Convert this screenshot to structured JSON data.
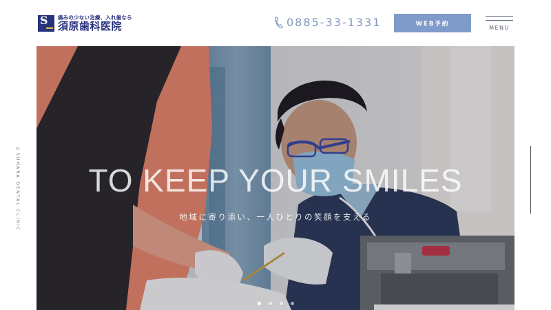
{
  "header": {
    "logo": {
      "tagline": "痛みの少ない治療、入れ歯なら",
      "name": "須原歯科医院",
      "mark_letter": "S"
    },
    "phone": {
      "icon": "phone-icon",
      "number": "0885-33-1331"
    },
    "web_reservation_label": "WEB予約",
    "menu_label": "MENU"
  },
  "side": {
    "copyright": "©SUHARA DENTAL CLINIC"
  },
  "hero": {
    "headline": "TO KEEP YOUR SMILES",
    "subline": "地域に寄り添い、一人ひとりの笑顔を支える",
    "photo": "dentist treating a patient",
    "slides": {
      "count": 4,
      "active": 1
    }
  },
  "colors": {
    "brand_navy": "#27327d",
    "accent_blue": "#7f9bc9",
    "phone_blue": "#7f96bd",
    "logo_gold": "#e9c34a"
  }
}
